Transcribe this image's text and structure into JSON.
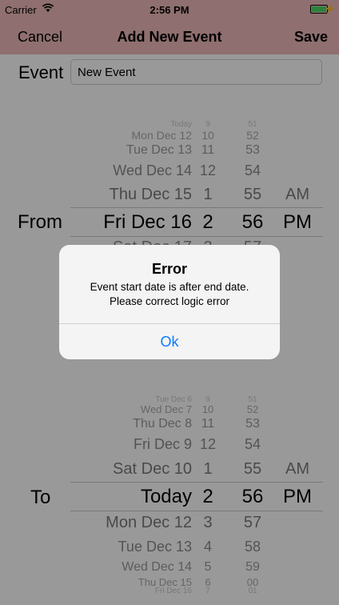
{
  "status": {
    "carrier": "Carrier",
    "time": "2:56 PM",
    "bolt": "⚡"
  },
  "nav": {
    "cancel": "Cancel",
    "title": "Add New Event",
    "save": "Save"
  },
  "event": {
    "label": "Event",
    "value": "New Event"
  },
  "from_picker": {
    "label": "From",
    "rows": [
      {
        "day": "Today",
        "hour": "9",
        "minute": "51",
        "ampm": ""
      },
      {
        "day": "Mon Dec 12",
        "hour": "10",
        "minute": "52",
        "ampm": ""
      },
      {
        "day": "Tue Dec 13",
        "hour": "11",
        "minute": "53",
        "ampm": ""
      },
      {
        "day": "Wed Dec 14",
        "hour": "12",
        "minute": "54",
        "ampm": ""
      },
      {
        "day": "Thu Dec 15",
        "hour": "1",
        "minute": "55",
        "ampm": "AM"
      },
      {
        "day": "Fri Dec 16",
        "hour": "2",
        "minute": "56",
        "ampm": "PM"
      },
      {
        "day": "Sat Dec 17",
        "hour": "3",
        "minute": "57",
        "ampm": ""
      }
    ]
  },
  "to_picker": {
    "label": "To",
    "rows": [
      {
        "day": "Tue Dec 6",
        "hour": "9",
        "minute": "51",
        "ampm": ""
      },
      {
        "day": "Wed Dec 7",
        "hour": "10",
        "minute": "52",
        "ampm": ""
      },
      {
        "day": "Thu Dec 8",
        "hour": "11",
        "minute": "53",
        "ampm": ""
      },
      {
        "day": "Fri Dec 9",
        "hour": "12",
        "minute": "54",
        "ampm": ""
      },
      {
        "day": "Sat Dec 10",
        "hour": "1",
        "minute": "55",
        "ampm": "AM"
      },
      {
        "day": "Today",
        "hour": "2",
        "minute": "56",
        "ampm": "PM"
      },
      {
        "day": "Mon Dec 12",
        "hour": "3",
        "minute": "57",
        "ampm": ""
      },
      {
        "day": "Tue Dec 13",
        "hour": "4",
        "minute": "58",
        "ampm": ""
      },
      {
        "day": "Wed Dec 14",
        "hour": "5",
        "minute": "59",
        "ampm": ""
      },
      {
        "day": "Thu Dec 15",
        "hour": "6",
        "minute": "00",
        "ampm": ""
      },
      {
        "day": "Fri Dec 16",
        "hour": "7",
        "minute": "01",
        "ampm": ""
      }
    ]
  },
  "alert": {
    "title": "Error",
    "message_line1": "Event start date is after end date.",
    "message_line2": "Please correct logic error",
    "ok": "Ok"
  },
  "colors": {
    "nav_bg": "#eeb9b9",
    "alert_button": "#0a7bff",
    "battery": "#4cd964"
  }
}
